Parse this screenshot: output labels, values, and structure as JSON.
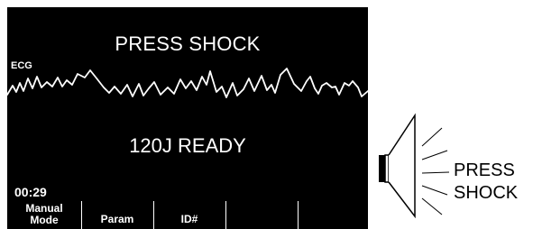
{
  "screen": {
    "prompt": "PRESS SHOCK",
    "ecg_label": "ECG",
    "status": "120J READY",
    "timer": "00:29"
  },
  "softkeys": {
    "manual_line1": "Manual",
    "manual_line2": "Mode",
    "param": "Param",
    "id": "ID#",
    "key4": "",
    "key5": ""
  },
  "speaker": {
    "label_line1": "PRESS",
    "label_line2": "SHOCK"
  }
}
